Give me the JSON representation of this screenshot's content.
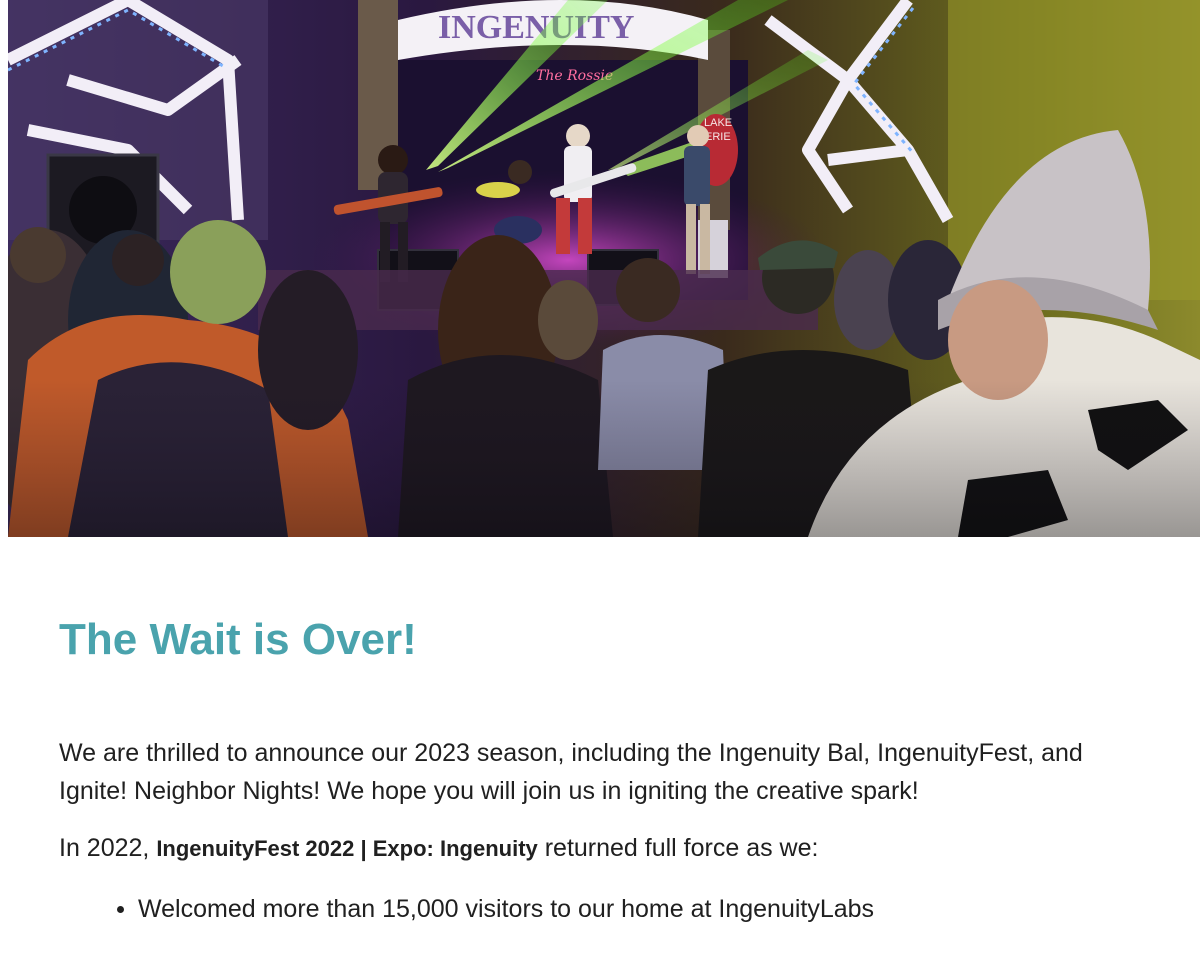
{
  "hero": {
    "sign_text": "INGENUITY",
    "neon_text": "The Rossie",
    "sign_lake": "LAKE",
    "sign_erie": "ERIE"
  },
  "article": {
    "headline": "The Wait is Over!",
    "intro": "We are thrilled to announce our 2023 season, including the Ingenuity Bal, IngenuityFest, and Ignite! Neighbor Nights! We hope you will join us in igniting the creative spark!",
    "recap_prefix": "In 2022, ",
    "recap_bold": "IngenuityFest 2022 | Expo: Ingenuity",
    "recap_suffix": " returned full force as we:",
    "bullets": [
      "Welcomed more than 15,000 visitors to our home at IngenuityLabs"
    ]
  },
  "colors": {
    "headline": "#4aa3ad",
    "body_text": "#202020",
    "laser_green": "#7dff3a",
    "stage_magenta": "#c43cc8"
  }
}
